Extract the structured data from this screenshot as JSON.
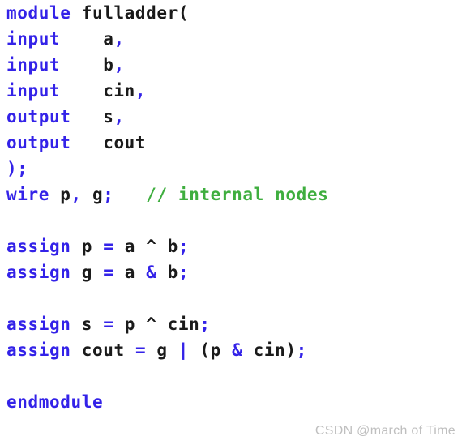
{
  "editor": {
    "language": "verilog",
    "background_color": "#ffffff",
    "keyword_color": "#3322e8",
    "identifier_color": "#1a1a1a",
    "comment_color": "#3fae3f",
    "watermark_color": "#bfbfbf"
  },
  "code": {
    "lines": [
      {
        "index": 0,
        "text": "module fulladder(",
        "tokens": [
          {
            "t": "module",
            "k": "kw"
          },
          {
            "t": " fulladder(",
            "k": "id"
          }
        ]
      },
      {
        "index": 1,
        "text": "input    a,",
        "tokens": [
          {
            "t": "input",
            "k": "kw"
          },
          {
            "t": "    a",
            "k": "id"
          },
          {
            "t": ",",
            "k": "punct"
          }
        ]
      },
      {
        "index": 2,
        "text": "input    b,",
        "tokens": [
          {
            "t": "input",
            "k": "kw"
          },
          {
            "t": "    b",
            "k": "id"
          },
          {
            "t": ",",
            "k": "punct"
          }
        ]
      },
      {
        "index": 3,
        "text": "input    cin,",
        "tokens": [
          {
            "t": "input",
            "k": "kw"
          },
          {
            "t": "    cin",
            "k": "id"
          },
          {
            "t": ",",
            "k": "punct"
          }
        ]
      },
      {
        "index": 4,
        "text": "output   s,",
        "tokens": [
          {
            "t": "output",
            "k": "kw"
          },
          {
            "t": "   s",
            "k": "id"
          },
          {
            "t": ",",
            "k": "punct"
          }
        ]
      },
      {
        "index": 5,
        "text": "output   cout",
        "tokens": [
          {
            "t": "output",
            "k": "kw"
          },
          {
            "t": "   cout",
            "k": "id"
          }
        ]
      },
      {
        "index": 6,
        "text": ");",
        "tokens": [
          {
            "t": ");",
            "k": "punct"
          }
        ]
      },
      {
        "index": 7,
        "text": "wire p, g;   // internal nodes",
        "tokens": [
          {
            "t": "wire",
            "k": "kw"
          },
          {
            "t": " p",
            "k": "id"
          },
          {
            "t": ",",
            "k": "punct"
          },
          {
            "t": " g",
            "k": "id"
          },
          {
            "t": ";",
            "k": "punct"
          },
          {
            "t": "   ",
            "k": "id"
          },
          {
            "t": "// internal nodes",
            "k": "comment"
          }
        ]
      },
      {
        "index": 8,
        "text": "",
        "tokens": []
      },
      {
        "index": 9,
        "text": "assign p = a ^ b;",
        "tokens": [
          {
            "t": "assign",
            "k": "kw"
          },
          {
            "t": " p ",
            "k": "id"
          },
          {
            "t": "=",
            "k": "punct"
          },
          {
            "t": " a ",
            "k": "id"
          },
          {
            "t": "^",
            "k": "op"
          },
          {
            "t": " b",
            "k": "id"
          },
          {
            "t": ";",
            "k": "punct"
          }
        ]
      },
      {
        "index": 10,
        "text": "assign g = a & b;",
        "tokens": [
          {
            "t": "assign",
            "k": "kw"
          },
          {
            "t": " g ",
            "k": "id"
          },
          {
            "t": "=",
            "k": "punct"
          },
          {
            "t": " a ",
            "k": "id"
          },
          {
            "t": "&",
            "k": "punct"
          },
          {
            "t": " b",
            "k": "id"
          },
          {
            "t": ";",
            "k": "punct"
          }
        ]
      },
      {
        "index": 11,
        "text": "",
        "tokens": []
      },
      {
        "index": 12,
        "text": "assign s = p ^ cin;",
        "tokens": [
          {
            "t": "assign",
            "k": "kw"
          },
          {
            "t": " s ",
            "k": "id"
          },
          {
            "t": "=",
            "k": "punct"
          },
          {
            "t": " p ",
            "k": "id"
          },
          {
            "t": "^",
            "k": "op"
          },
          {
            "t": " cin",
            "k": "id"
          },
          {
            "t": ";",
            "k": "punct"
          }
        ]
      },
      {
        "index": 13,
        "text": "assign cout = g | (p & cin);",
        "tokens": [
          {
            "t": "assign",
            "k": "kw"
          },
          {
            "t": " cout ",
            "k": "id"
          },
          {
            "t": "=",
            "k": "punct"
          },
          {
            "t": " g ",
            "k": "id"
          },
          {
            "t": "|",
            "k": "punct"
          },
          {
            "t": " (p ",
            "k": "id"
          },
          {
            "t": "&",
            "k": "punct"
          },
          {
            "t": " cin)",
            "k": "id"
          },
          {
            "t": ";",
            "k": "punct"
          }
        ]
      },
      {
        "index": 14,
        "text": "",
        "tokens": []
      },
      {
        "index": 15,
        "text": "endmodule",
        "tokens": [
          {
            "t": "endmodule",
            "k": "kw"
          }
        ]
      }
    ]
  },
  "watermark": {
    "text": "CSDN @march of Time"
  }
}
